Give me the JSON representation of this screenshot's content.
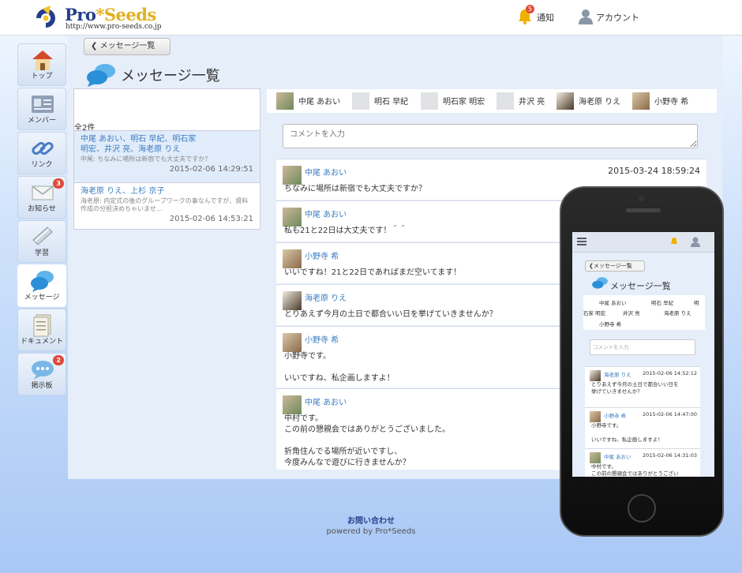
{
  "header": {
    "logo_title_a": "Pro",
    "logo_title_b": "Seeds",
    "logo_url": "http://www.pro-seeds.co.jp",
    "notify_label": "通知",
    "notify_badge": "5",
    "account_label": "アカウント"
  },
  "sidebar": {
    "items": [
      {
        "label": "トップ",
        "icon": "home-icon",
        "badge": ""
      },
      {
        "label": "メンバー",
        "icon": "members-icon",
        "badge": ""
      },
      {
        "label": "リンク",
        "icon": "link-icon",
        "badge": ""
      },
      {
        "label": "お知らせ",
        "icon": "mail-icon",
        "badge": "3"
      },
      {
        "label": "学習",
        "icon": "study-icon",
        "badge": ""
      },
      {
        "label": "メッセージ",
        "icon": "message-icon",
        "badge": ""
      },
      {
        "label": "ドキュメント",
        "icon": "document-icon",
        "badge": ""
      },
      {
        "label": "掲示板",
        "icon": "board-icon",
        "badge": "2"
      }
    ]
  },
  "back_label": "メッセージ一覧",
  "page_title": "メッセージ一覧",
  "threads": {
    "count": "全2件",
    "items": [
      {
        "who": "中尾 あおい、明石 早紀、明石家\n明宏、井沢 亮、海老原 りえ",
        "preview": "中尾: ちなみに場所は新宿でも大丈夫ですか？",
        "date": "2015-02-06 14:29:51"
      },
      {
        "who": "海老原 りえ、上杉 京子",
        "preview": "海老原: 内定式の後のグループワークの事なんですが、資料作成の分担決めちゃいませ...",
        "date": "2015-02-06 14:53:21"
      }
    ]
  },
  "members": [
    "中尾 あおい",
    "明石 早紀",
    "明石家 明宏",
    "井沢 亮",
    "海老原 りえ",
    "小野寺 希"
  ],
  "comment_placeholder": "コメントを入力",
  "messages": [
    {
      "name": "中尾 あおい",
      "date": "2015-03-24 18:59:24",
      "body": "ちなみに場所は新宿でも大丈夫ですか？"
    },
    {
      "name": "中尾 あおい",
      "date": "",
      "body": "私も21と22日は大丈夫です！＾＾"
    },
    {
      "name": "小野寺 希",
      "date": "",
      "body": "いいですね！21と22日であればまだ空いてます！"
    },
    {
      "name": "海老原 りえ",
      "date": "",
      "body": "とりあえず今月の土日で都合いい日を挙げていきませんか？"
    },
    {
      "name": "小野寺 希",
      "date": "",
      "body": "小野寺です。\n\nいいですね、私企画しますよ！"
    },
    {
      "name": "中尾 あおい",
      "date": "",
      "body": "中村です。\nこの前の懇親会ではありがとうございました。\n\n折角住んでる場所が近いですし、\n今度みんなで遊びに行きませんか？"
    }
  ],
  "footer": {
    "contact": "お問い合わせ",
    "powered": "powered by Pro*Seeds"
  },
  "phone": {
    "back_label": "メッセージ一覧",
    "title": "メッセージ一覧",
    "members": [
      "中尾 あおい",
      "明石 早紀",
      "明",
      "石家 明宏",
      "井沢 亮",
      "海老原 りえ",
      "小野寺 希"
    ],
    "comment_placeholder": "コメントを入力",
    "messages": [
      {
        "name": "海老原 りえ",
        "date": "2015-02-06 14:52:12",
        "body": "とりあえず今月の土日で都合いい日を\n挙げていきませんか？"
      },
      {
        "name": "小野寺 希",
        "date": "2015-02-06 14:47:00",
        "body": "小野寺です。\n\nいいですね、私企画しますよ！"
      },
      {
        "name": "中尾 あおい",
        "date": "2015-02-06 14:31:03",
        "body": "中村です。\nこの前の懇親会ではありがとうござい"
      }
    ]
  },
  "colors": {
    "accent": "#3a7cc2",
    "brand": "#243e8a",
    "badge": "#e04a3a"
  }
}
